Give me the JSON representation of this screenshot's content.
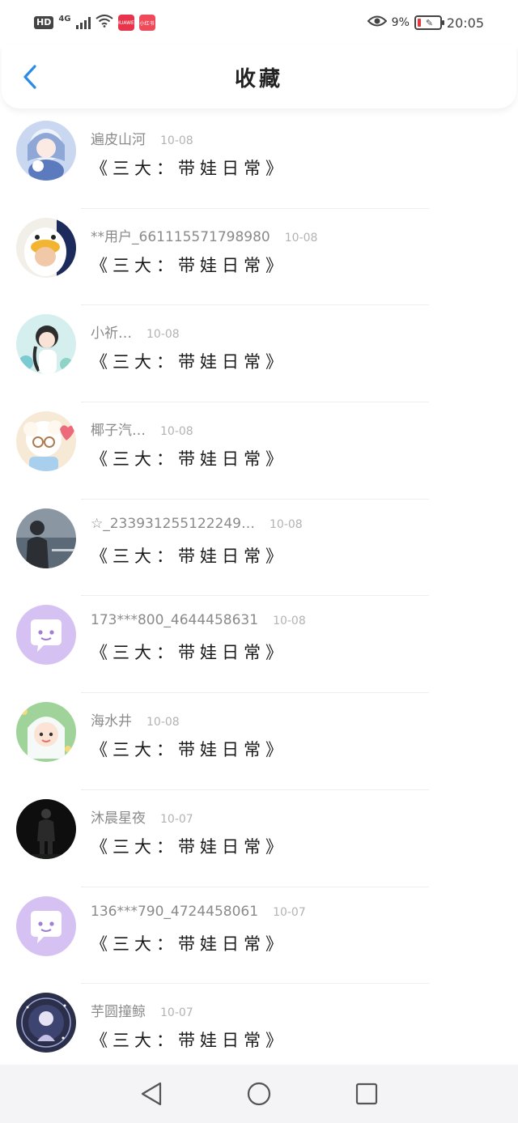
{
  "status_bar": {
    "hd": "HD",
    "network": "4G",
    "app_badge_1": "HUAWEI",
    "app_badge_2": "小红书",
    "battery": "9%",
    "time": "20:05"
  },
  "header": {
    "title": "收藏",
    "back_icon": "chevron-left-icon"
  },
  "colors": {
    "accent": "#2a8ce6",
    "username": "#8a8a8a",
    "date": "#b3b3b3",
    "title": "#1a1a1a"
  },
  "favorites": [
    {
      "username": "遍皮山河",
      "date": "10-08",
      "title": "《三大：带娃日常》",
      "avatar": "anime-girl-blue"
    },
    {
      "username": "**用户_661115571798980",
      "date": "10-08",
      "title": "《三大：带娃日常》",
      "avatar": "duck-costume"
    },
    {
      "username": "小祈…",
      "date": "10-08",
      "title": "《三大：带娃日常》",
      "avatar": "girl-braid"
    },
    {
      "username": "椰子汽…",
      "date": "10-08",
      "title": "《三大：带娃日常》",
      "avatar": "sheep-heart"
    },
    {
      "username": "☆_2339312551222​49…",
      "date": "10-08",
      "title": "《三大：带娃日常》",
      "avatar": "person-sea"
    },
    {
      "username": "173***800_4644458631",
      "date": "10-08",
      "title": "《三大：带娃日常》",
      "avatar": "chat-bubble-default"
    },
    {
      "username": "海水井",
      "date": "10-08",
      "title": "《三大：带娃日常》",
      "avatar": "kid-hood"
    },
    {
      "username": "沐晨星夜",
      "date": "10-07",
      "title": "《三大：带娃日常》",
      "avatar": "dark-figure"
    },
    {
      "username": "136***790_4724458061",
      "date": "10-07",
      "title": "《三大：带娃日常》",
      "avatar": "chat-bubble-default"
    },
    {
      "username": "芋圆撞鲸",
      "date": "10-07",
      "title": "《三大：带娃日常》",
      "avatar": "starry-girl"
    }
  ],
  "nav_bar": {
    "back": "triangle-back-icon",
    "home": "circle-home-icon",
    "recents": "square-recents-icon"
  }
}
